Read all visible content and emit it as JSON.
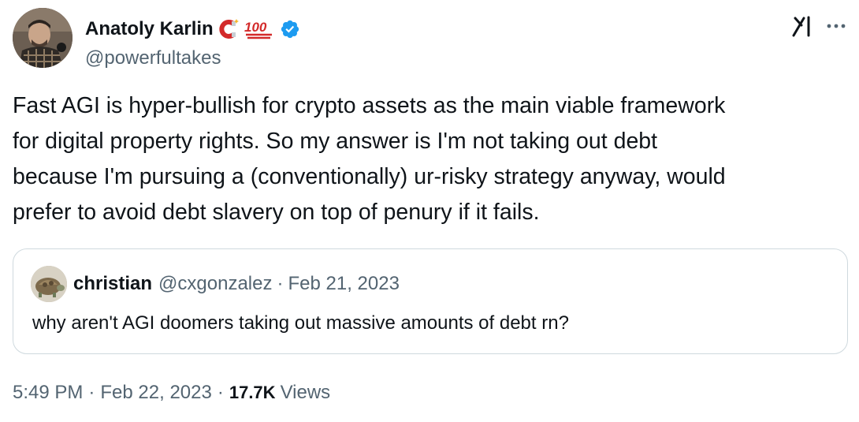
{
  "author": {
    "display_name": "Anatoly Karlin",
    "handle": "@powerfultakes",
    "emoji_badges": [
      "magnet-emoji",
      "hundred-points-emoji"
    ],
    "verified": true
  },
  "icons": {
    "grok": "grok-icon",
    "more": "more-options-icon"
  },
  "tweet": {
    "text": "Fast AGI is hyper-bullish for crypto assets as the main viable framework\nfor digital property rights. So my answer is I'm not taking out debt\nbecause I'm pursuing a (conventionally) ur-risky strategy anyway, would\nprefer to avoid debt slavery on top of penury if it fails."
  },
  "quote": {
    "display_name": "christian",
    "handle": "@cxgonzalez",
    "separator": "·",
    "date": "Feb 21, 2023",
    "text": "why aren't AGI doomers taking out massive amounts of debt rn?"
  },
  "meta": {
    "time": "5:49 PM",
    "separator": "·",
    "date": "Feb 22, 2023",
    "views_count": "17.7K",
    "views_label": "Views"
  },
  "colors": {
    "text": "#0f1419",
    "secondary": "#536471",
    "verified_blue": "#1d9bf0",
    "border": "#cfd9de"
  }
}
